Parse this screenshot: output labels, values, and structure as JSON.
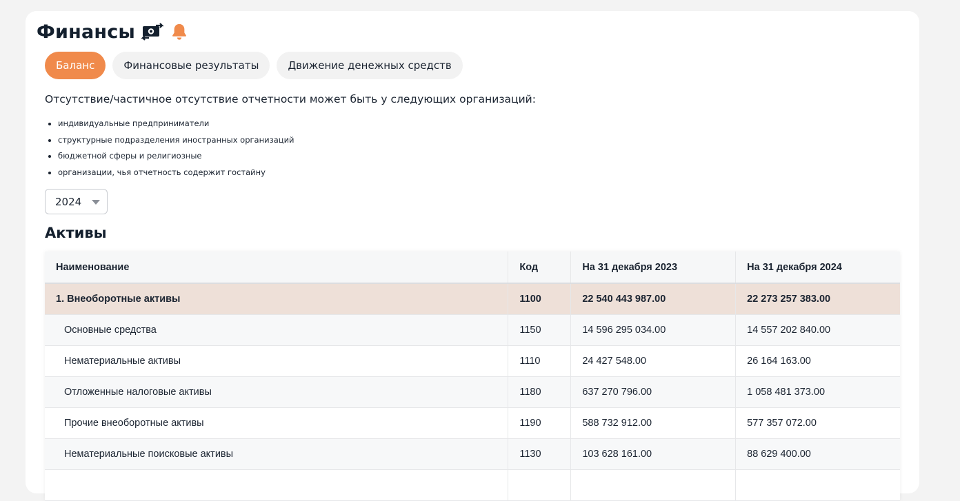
{
  "header": {
    "title": "Финансы",
    "money_icon": "money-exchange-icon",
    "bell_icon": "bell-icon",
    "accent_color": "#f08a4b"
  },
  "tabs": [
    {
      "label": "Баланс",
      "active": true
    },
    {
      "label": "Финансовые результаты",
      "active": false
    },
    {
      "label": "Движение денежных средств",
      "active": false
    }
  ],
  "notice": {
    "text": "Отсутствие/частичное отсутствие отчетности может быть у следующих организаций:",
    "items": [
      "индивидуальные предприниматели",
      "структурные подразделения иностранных организаций",
      "бюджетной сферы и религиозные",
      "организации, чья отчетность содержит гостайну"
    ]
  },
  "year_select": {
    "value": "2024"
  },
  "assets": {
    "title": "Активы",
    "columns": [
      "Наименование",
      "Код",
      "На 31 декабря 2023",
      "На 31 декабря 2024"
    ],
    "rows": [
      {
        "name": "1. Внеоборотные активы",
        "code": "1100",
        "y2023": "22 540 443 987.00",
        "y2024": "22 273 257 383.00",
        "group": true
      },
      {
        "name": "Основные средства",
        "code": "1150",
        "y2023": "14 596 295 034.00",
        "y2024": "14 557 202 840.00"
      },
      {
        "name": "Нематериальные активы",
        "code": "1110",
        "y2023": "24 427 548.00",
        "y2024": "26 164 163.00"
      },
      {
        "name": "Отложенные налоговые активы",
        "code": "1180",
        "y2023": "637 270 796.00",
        "y2024": "1 058 481 373.00"
      },
      {
        "name": "Прочие внеоборотные активы",
        "code": "1190",
        "y2023": "588 732 912.00",
        "y2024": "577 357 072.00"
      },
      {
        "name": "Нематериальные поисковые активы",
        "code": "1130",
        "y2023": "103 628 161.00",
        "y2024": "88 629 400.00"
      }
    ]
  }
}
